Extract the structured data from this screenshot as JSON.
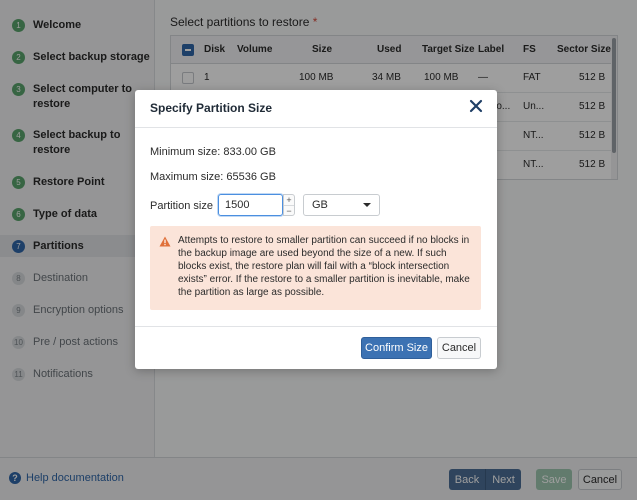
{
  "sidebar": {
    "steps": [
      {
        "num": "1",
        "label": "Welcome",
        "state": "done"
      },
      {
        "num": "2",
        "label": "Select backup storage",
        "state": "done"
      },
      {
        "num": "3",
        "label": "Select computer to restore",
        "state": "done"
      },
      {
        "num": "4",
        "label": "Select backup to restore",
        "state": "done"
      },
      {
        "num": "5",
        "label": "Restore Point",
        "state": "done"
      },
      {
        "num": "6",
        "label": "Type of data",
        "state": "done"
      },
      {
        "num": "7",
        "label": "Partitions",
        "state": "current"
      },
      {
        "num": "8",
        "label": "Destination",
        "state": "todo"
      },
      {
        "num": "9",
        "label": "Encryption options",
        "state": "todo"
      },
      {
        "num": "10",
        "label": "Pre / post actions",
        "state": "todo"
      },
      {
        "num": "11",
        "label": "Notifications",
        "state": "todo"
      }
    ]
  },
  "main": {
    "title": "Select partitions to restore",
    "required_mark": "*",
    "table": {
      "headers": [
        "Disk",
        "Volume",
        "Size",
        "Used",
        "Target Size",
        "Label",
        "FS",
        "Sector Size"
      ],
      "rows": [
        [
          "1",
          "",
          "100 MB",
          "34 MB",
          "100 MB",
          "—",
          "FAT",
          "512 B"
        ],
        [
          "",
          "",
          "",
          "",
          "",
          "ro...",
          "Un...",
          "512 B"
        ],
        [
          "",
          "",
          "",
          "",
          "",
          "",
          "NT...",
          "512 B"
        ],
        [
          "",
          "",
          "",
          "",
          "",
          "",
          "NT...",
          "512 B"
        ]
      ]
    }
  },
  "footer": {
    "help": "Help documentation",
    "back": "Back",
    "next": "Next",
    "save": "Save",
    "cancel": "Cancel"
  },
  "dialog": {
    "title": "Specify Partition Size",
    "min_size": "Minimum size: 833.00 GB",
    "max_size": "Maximum size: 65536 GB",
    "partition_size_label": "Partition size",
    "partition_size_value": "1500",
    "stepper_up": "+",
    "stepper_down": "−",
    "unit": "GB",
    "warning": "Attempts to restore to smaller partition can succeed if no blocks in the backup image are used beyond the size of a new. If such blocks exist, the restore plan will fail with a “block intersection exists” error. If the restore to a smaller partition is inevitable, make the partition as large as possible.",
    "confirm": "Confirm Size",
    "cancel": "Cancel"
  },
  "colors": {
    "accent": "#3c72b3",
    "done_step": "#5aa36c",
    "warning_bg": "#fbe4d9",
    "warning_icon": "#e0703a"
  }
}
